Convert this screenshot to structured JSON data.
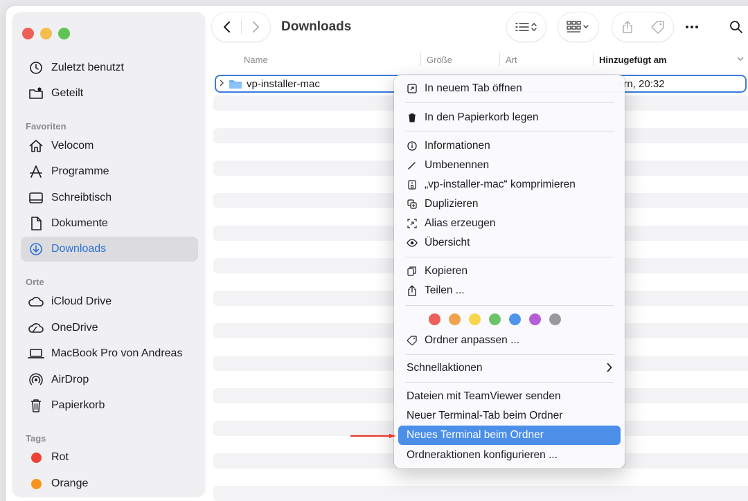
{
  "toolbar": {
    "title": "Downloads"
  },
  "sidebar": {
    "top_items": [
      {
        "label": "Zuletzt benutzt",
        "icon": "clock-icon"
      },
      {
        "label": "Geteilt",
        "icon": "shared-folder-icon"
      }
    ],
    "sections": {
      "favorites": "Favoriten",
      "places": "Orte",
      "tags": "Tags"
    },
    "favorites": [
      {
        "label": "Velocom",
        "icon": "home-icon"
      },
      {
        "label": "Programme",
        "icon": "applications-icon"
      },
      {
        "label": "Schreibtisch",
        "icon": "desktop-icon"
      },
      {
        "label": "Dokumente",
        "icon": "document-icon"
      },
      {
        "label": "Downloads",
        "icon": "download-icon",
        "active": true
      }
    ],
    "places": [
      {
        "label": "iCloud Drive",
        "icon": "cloud-icon"
      },
      {
        "label": "OneDrive",
        "icon": "onedrive-icon"
      },
      {
        "label": "MacBook Pro von Andreas",
        "icon": "laptop-icon"
      },
      {
        "label": "AirDrop",
        "icon": "airdrop-icon"
      },
      {
        "label": "Papierkorb",
        "icon": "trash-icon"
      }
    ],
    "tags": [
      {
        "label": "Rot",
        "color": "#ee4035"
      },
      {
        "label": "Orange",
        "color": "#f7941d"
      }
    ]
  },
  "columns": {
    "name": "Name",
    "size": "Größe",
    "kind": "Art",
    "date_added": "Hinzugefügt am"
  },
  "file": {
    "name": "vp-installer-mac",
    "date_fragment": "ern, 20:32"
  },
  "context_menu": {
    "items": {
      "open_new_tab": "In neuem Tab öffnen",
      "move_to_trash": "In den Papierkorb legen",
      "get_info": "Informationen",
      "rename": "Umbenennen",
      "compress": "„vp-installer-mac“ komprimieren",
      "duplicate": "Duplizieren",
      "make_alias": "Alias erzeugen",
      "quick_look": "Übersicht",
      "copy": "Kopieren",
      "share": "Teilen ...",
      "tags": "Ordner anpassen ...",
      "quick_actions": "Schnellaktionen",
      "teamviewer": "Dateien mit TeamViewer senden",
      "new_terminal_tab": "Neuer Terminal-Tab beim Ordner",
      "new_terminal": "Neues Terminal beim Ordner",
      "folder_actions": "Ordneraktionen konfigurieren ..."
    },
    "tag_colors": [
      "#ec5f5a",
      "#f2a14c",
      "#f7d54c",
      "#6cc46a",
      "#4e96ec",
      "#b45ed8",
      "#9a9a9e"
    ]
  },
  "colors": {
    "accent": "#2a6fd6",
    "highlight": "#4b8fe8",
    "annotation_arrow": "#e8382e"
  }
}
